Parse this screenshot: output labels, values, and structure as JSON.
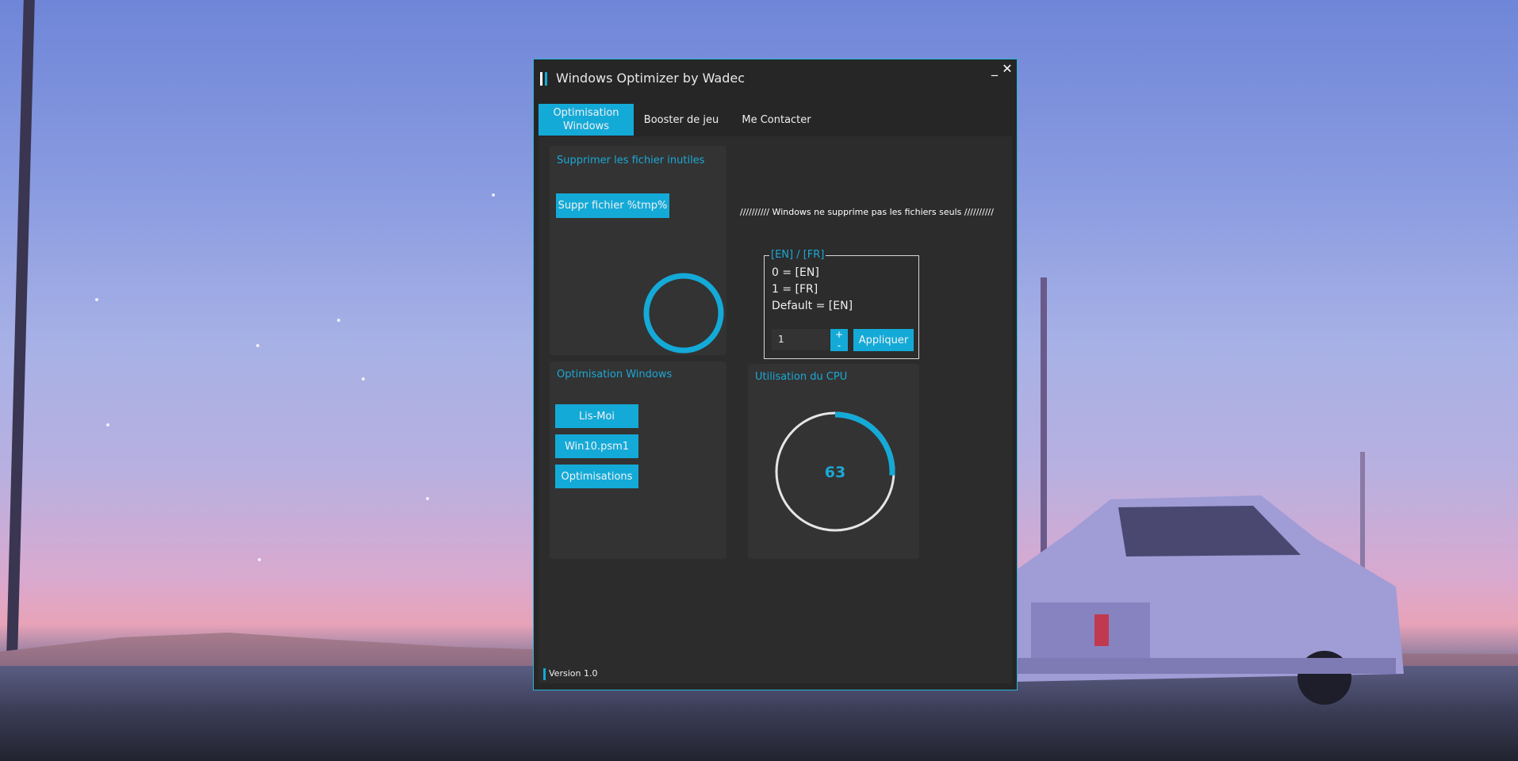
{
  "window": {
    "title": "Windows Optimizer by Wadec",
    "minimize_glyph": "_",
    "close_glyph": "✕",
    "accent": "#14aad8"
  },
  "tabs": [
    {
      "label_line1": "Optimisation",
      "label_line2": "Windows",
      "active": true
    },
    {
      "label": "Booster de jeu",
      "active": false
    },
    {
      "label": "Me Contacter",
      "active": false
    }
  ],
  "cleanup_panel": {
    "title": "Supprimer les fichier inutiles",
    "button": "Suppr fichier %tmp%"
  },
  "notice": "//////////  Windows ne supprime pas les fichiers seuls //////////",
  "language_box": {
    "legend": "[EN] / [FR]",
    "lines": [
      "0 = [EN]",
      "1 = [FR]",
      "Default = [EN]"
    ],
    "value": "1",
    "stepper_up": "+",
    "stepper_down": "-",
    "apply_button": "Appliquer"
  },
  "optimization_panel": {
    "title": "Optimisation Windows",
    "buttons": [
      "Lis-Moi",
      "Win10.psm1",
      "Optimisations"
    ]
  },
  "cpu_panel": {
    "title": "Utilisation du CPU",
    "value": "63",
    "fraction": 0.26
  },
  "footer": {
    "version": "Version 1.0"
  }
}
